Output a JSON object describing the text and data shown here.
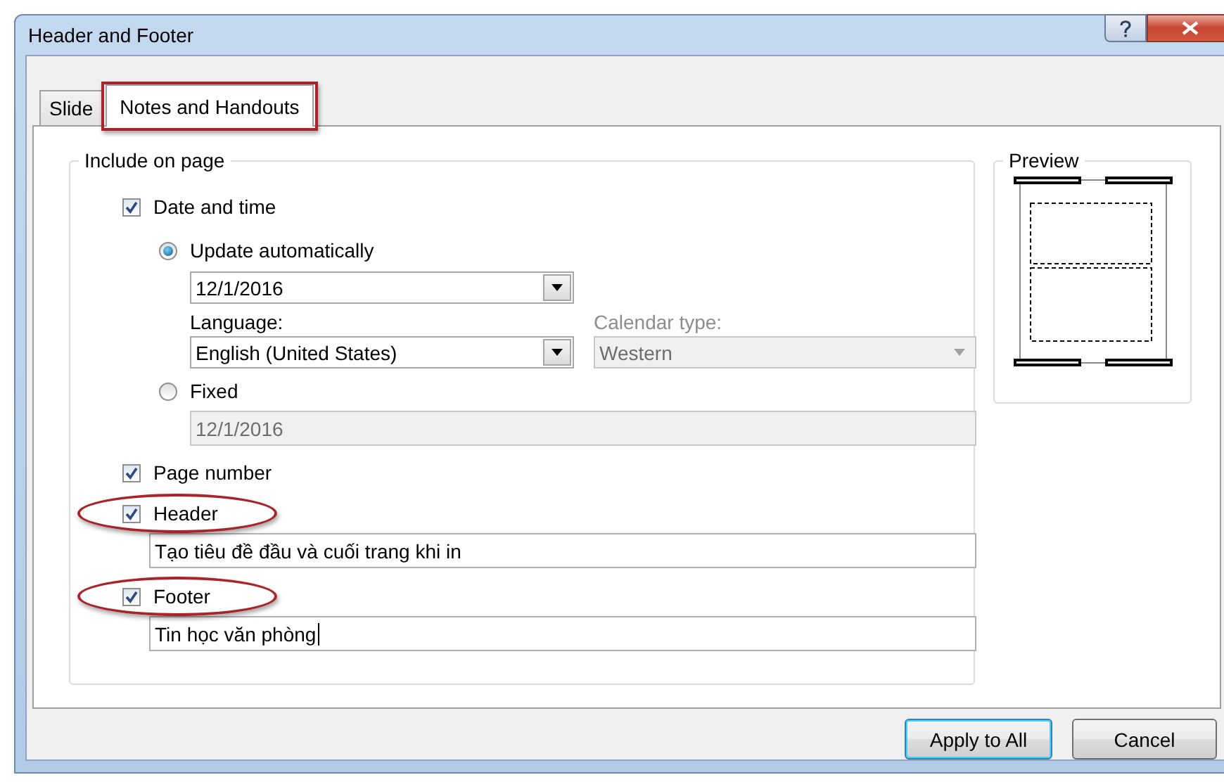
{
  "window": {
    "title": "Header and Footer"
  },
  "tabs": [
    {
      "label": "Slide",
      "selected": false,
      "annotated": false
    },
    {
      "label": "Notes and Handouts",
      "selected": true,
      "annotated": true
    }
  ],
  "include_on_page": {
    "title": "Include on page",
    "date_and_time": {
      "label": "Date and time",
      "checked": true
    },
    "update_automatically": {
      "label": "Update automatically",
      "selected": true
    },
    "date_format": {
      "value": "12/1/2016",
      "disabled": false
    },
    "language": {
      "label": "Language:",
      "value": "English (United States)",
      "disabled": false
    },
    "calendar_type": {
      "label": "Calendar type:",
      "value": "Western",
      "disabled": true
    },
    "fixed": {
      "label": "Fixed",
      "selected": false
    },
    "fixed_date": {
      "value": "12/1/2016",
      "disabled": true
    },
    "page_number": {
      "label": "Page number",
      "checked": true
    },
    "header": {
      "label": "Header",
      "checked": true,
      "annotated": true,
      "text": "Tạo tiêu đề đầu và cuối trang khi in",
      "focused": false
    },
    "footer": {
      "label": "Footer",
      "checked": true,
      "annotated": true,
      "text": "Tin học văn phòng",
      "focused": true
    }
  },
  "preview": {
    "title": "Preview"
  },
  "buttons": [
    {
      "label": "Apply to All",
      "default": true
    },
    {
      "label": "Cancel",
      "default": false
    }
  ]
}
